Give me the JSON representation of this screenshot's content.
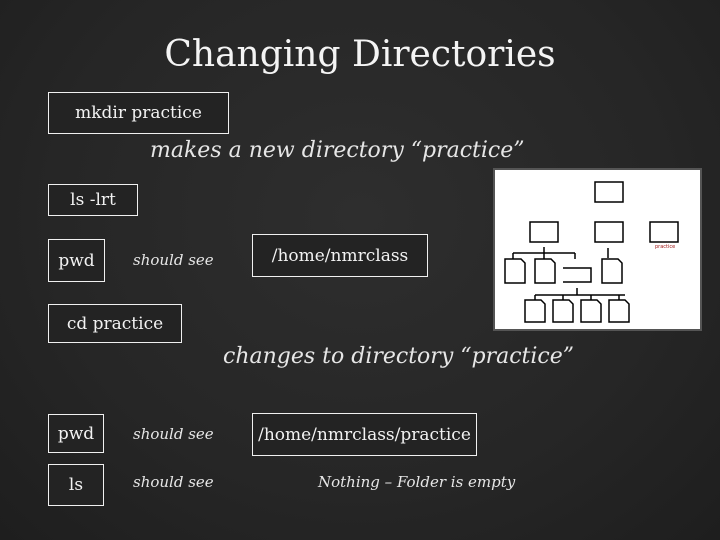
{
  "slide": {
    "title": "Changing Directories",
    "commands": {
      "mkdir": "mkdir  practice",
      "mkdir_note": "makes a new directory “practice”",
      "ls_lrt": "ls  -lrt",
      "pwd1": "pwd",
      "should_see_1": "should see",
      "pwd1_result": "/home/nmrclass",
      "cd": "cd  practice",
      "cd_note": "changes to directory “practice”",
      "pwd2": "pwd",
      "should_see_2": "should see",
      "pwd2_result": "/home/nmrclass/practice",
      "ls": "ls",
      "should_see_3": "should see",
      "ls_result": "Nothing – Folder is empty"
    },
    "diagram": {
      "highlight_label": "practice",
      "highlight_color": "#a01818"
    }
  }
}
